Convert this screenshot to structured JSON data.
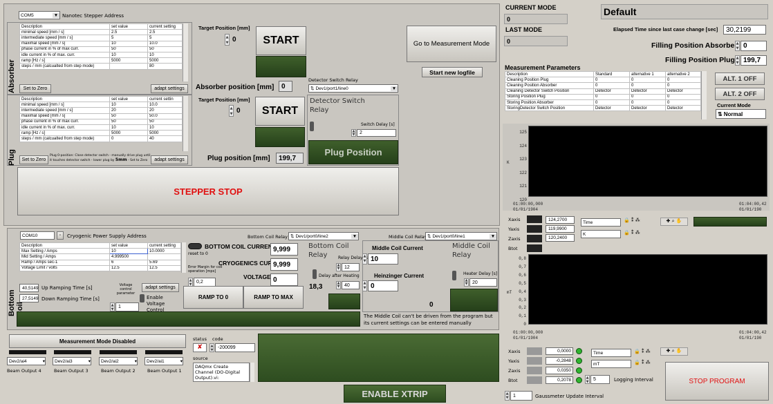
{
  "stepper": {
    "com": "COM5",
    "address_label": "Nanotec Stepper Address",
    "absorber_label": "Absorber",
    "plug_label": "Plug",
    "col_desc": "Description",
    "col_set": "set value",
    "col_cur": "current setting",
    "col_cur_short": "current settin",
    "absorber_rows": [
      [
        "minimal speed [mm / s]",
        "2.5",
        "2.5"
      ],
      [
        "intermediate speed [mm / s]",
        "5",
        "5"
      ],
      [
        "maximal speed [mm / s]",
        "10",
        "10.0"
      ],
      [
        "phase current in % of max curr.",
        "50",
        "50"
      ],
      [
        "idle current in % of max. curr.",
        "10",
        "10"
      ],
      [
        "ramp [Hz / s]",
        "5000",
        "5000"
      ],
      [
        "steps / mm (calcualted from step mode)",
        "",
        "80"
      ]
    ],
    "plug_rows": [
      [
        "minimal speed [mm / s]",
        "10",
        "10.0"
      ],
      [
        "intermediate speed [mm / s]",
        "20",
        "20"
      ],
      [
        "maximal speed [mm / s]",
        "50",
        "50.0"
      ],
      [
        "phase current in % of max curr.",
        "50",
        "50"
      ],
      [
        "idle current in % of max. curr.",
        "10",
        "10"
      ],
      [
        "ramp [Hz / s]",
        "5000",
        "5000"
      ],
      [
        "steps / mm (calcualted from step mode)",
        "0",
        "40"
      ]
    ],
    "set_zero": "Set to Zero",
    "adapt": "adapt settings",
    "plug_note1": "Plug 0-position: Close detector switch - manually drive plug until",
    "plug_note2": "it touches detector switch - lower plug by",
    "plug_note_bold": "5mm",
    "plug_note3": "- Set to Zero",
    "target_label": "Target Position [mm]",
    "target_abs": "0",
    "target_plug": "0",
    "start": "START",
    "absorber_pos_label": "Absorber position [mm]",
    "absorber_pos": "0",
    "plug_pos_label": "Plug position [mm]",
    "plug_pos": "199,7",
    "stop": "STEPPER STOP"
  },
  "detector": {
    "relay_label": "Detector Switch Relay",
    "relay_value": "Dev1/port1/line0",
    "title": "Detector Switch Relay",
    "delay_label": "Switch Delay [s]",
    "delay": "2",
    "plug_position": "Plug Position"
  },
  "measure_btn": "Go to Measurement Mode",
  "new_log": "Start new logfile",
  "mode": {
    "current_label": "CURRENT MODE",
    "current": "0",
    "last_label": "LAST MODE",
    "last": "0",
    "name": "Default",
    "elapsed_label": "Elapsed Time since last case change [sec]",
    "elapsed": "30,2199",
    "fill_abs_label": "Filling Position Absorber",
    "fill_abs": "0",
    "fill_plug_label": "Filling Position Plug",
    "fill_plug": "199,7",
    "alt1": "ALT. 1 OFF",
    "alt2": "ALT. 2 OFF",
    "cm_label": "Current Mode",
    "cm_value": "Normal"
  },
  "meas_params": {
    "title": "Measurement Parameters",
    "header": [
      "Description",
      "Standard",
      "alternative 1",
      "alternative 2"
    ],
    "rows": [
      [
        "Cleaning Position Plug",
        "0",
        "0",
        "0"
      ],
      [
        "Cleaning Position Absorber",
        "0",
        "0",
        "0"
      ],
      [
        "Cleaning Detector Switch Position",
        "Detector",
        "Detector",
        "Detector"
      ],
      [
        "Storing Position Plug",
        "0",
        "0",
        "0"
      ],
      [
        "Storing Position Absorber",
        "0",
        "0",
        "0"
      ],
      [
        "StoringDetector Switch Position",
        "Detector",
        "Detector",
        "Detector"
      ]
    ]
  },
  "plot1": {
    "y_ticks": [
      "125",
      "124",
      "123",
      "122",
      "121",
      "120"
    ],
    "y_unit": "K",
    "x_left": [
      "01:00:00,000",
      "01/01/1904"
    ],
    "x_right": [
      "01:04:00,42",
      "01/01/190"
    ],
    "xaxis": "Xaxis",
    "yaxis": "Yaxis",
    "zaxis": "Zaxis",
    "btot": "Btot",
    "xval": "124,2700",
    "yval": "119,9900",
    "zval": "120,2400",
    "x_sel": "Time",
    "y_sel": "K"
  },
  "plot2": {
    "y_ticks": [
      "0,8",
      "0,7",
      "0,6",
      "0,5",
      "0,4",
      "0,3",
      "0,2",
      "0,1",
      "0"
    ],
    "y_unit": "mT",
    "x_left": [
      "01:00:00,000",
      "01/01/1904"
    ],
    "x_right": [
      "01:04:00,42",
      "01/01/190"
    ],
    "xval": "0,0000",
    "yval": "-0,2848",
    "zval": "0,0350",
    "bval": "0,2078",
    "x_sel": "Time",
    "y_sel": "mT",
    "log_interval": "5",
    "log_label": "Logging Interval",
    "gauss": "1",
    "gauss_label": "Gaussmeter Update Interval"
  },
  "stop_program": "STOP PROGRAM",
  "cryo": {
    "com": "COM10",
    "address_label": "Cryogenic Power Supply Address",
    "bottom_label": "Bottom Coil",
    "header": [
      "Description",
      "set value",
      "current setting"
    ],
    "rows": [
      [
        "Max Setting / Amps",
        "10",
        "10.0000"
      ],
      [
        "Mid Setting / Amps",
        "4.999500",
        ""
      ],
      [
        "Ramp / Amps sec-1",
        "6",
        "5.69"
      ],
      [
        "Voltage Limit / volts",
        "12.5",
        "12.5"
      ]
    ],
    "up_time": "40,5149",
    "up_label": "Up Ramping Time [s]",
    "down_time": "27,5149",
    "down_label": "Down Ramping Time [s]",
    "vctrl_label": "Voltage control parameter",
    "vctrl": "1",
    "adapt": "adapt settings",
    "enable_v": "Enable Voltage Control",
    "bcc_label": "BOTTOM COIL CURRENT",
    "bcc": "9,999",
    "reset": "reset to 0",
    "cryo_label": "CRYOGENICS CURRENT",
    "cryo": "9,999",
    "volt_label": "VOLTAGE",
    "volt": "0",
    "err_label": "Error Margin for coil operation [mps]",
    "err": "0,2",
    "ramp0": "RAMP TO 0",
    "rampmax": "RAMP TO MAX"
  },
  "bottom_relay": {
    "label": "Bottom Coil Relay",
    "value": "Dev1/port0/line2",
    "title": "Bottom Coil Relay",
    "relay_delay_label": "Relay Delay [s]",
    "relay_delay": "12",
    "after_label": "Delay after Heating",
    "after": "40",
    "value_disp": "18,3"
  },
  "middle_relay": {
    "label": "Middle Coil Relay",
    "value": "Dev1/port0/line1",
    "title": "Middle Coil Relay",
    "mcc_label": "Middle Coil Current",
    "mcc": "10",
    "hz_label": "Heinzinger Current",
    "hz": "0",
    "heater_label": "Heater Delay [s]",
    "heater": "20",
    "disp": "0",
    "note": "The Middle Coil can't be driven from the program but its current settings can be entered manually"
  },
  "beam": {
    "disabled": "Measurement Mode Disabled",
    "outputs": [
      {
        "dev": "Dev2/ai4",
        "label": "Beam Output 4"
      },
      {
        "dev": "Dev2/ai3",
        "label": "Beam Output 3"
      },
      {
        "dev": "Dev2/ai2",
        "label": "Beam Output 2"
      },
      {
        "dev": "Dev2/ai1",
        "label": "Beam Output 1"
      }
    ]
  },
  "error": {
    "status": "status",
    "code_label": "code",
    "code": "-200099",
    "source_label": "source",
    "source": "DAQmx Create Channel (DO-Digital Output).vi:"
  },
  "xtrip": "ENABLE XTRIP"
}
